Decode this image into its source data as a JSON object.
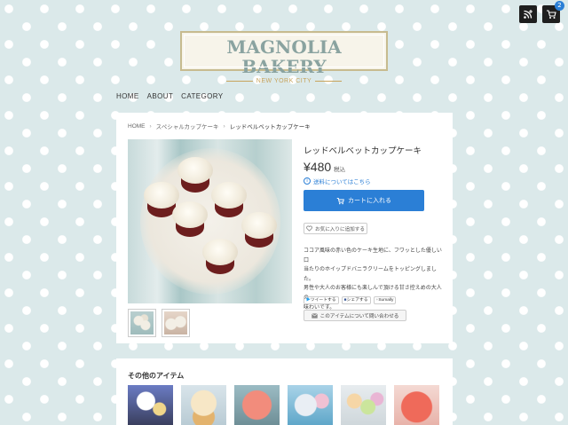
{
  "header": {
    "feed_icon": "feed-plus-icon",
    "cart_icon": "cart-icon",
    "cart_count": "2",
    "accent_color": "#2b7fd6"
  },
  "logo": {
    "name": "MAGNOLIA BAKERY",
    "sub": "NEW YORK CITY"
  },
  "nav": {
    "items": [
      "HOME",
      "ABOUT",
      "CATEGORY"
    ]
  },
  "breadcrumb": {
    "items": [
      "HOME",
      "スペシャルカップケーキ",
      "レッドベルベットカップケーキ"
    ],
    "separator": "›"
  },
  "product": {
    "title": "レッドベルベットカップケーキ",
    "price": "¥480",
    "tax_label": "税込",
    "shipping_link": "送料についてはこちら",
    "cart_button": "カートに入れる",
    "favorite_button": "お気に入りに追加する",
    "description": [
      "ココア風味の赤い色のケーキ生地に、フワッとした優しい口",
      "当たりのホイップドバニラクリームをトッピングしました。",
      "男性や大人のお客様にも楽しんで頂ける甘さ控えめの大人の",
      "味わいです。"
    ],
    "share": [
      "ツイートする",
      "シェアする",
      "Sumally"
    ],
    "contact_button": "このアイテムについて問い合わせる"
  },
  "other_items": {
    "title": "その他のアイテム"
  }
}
